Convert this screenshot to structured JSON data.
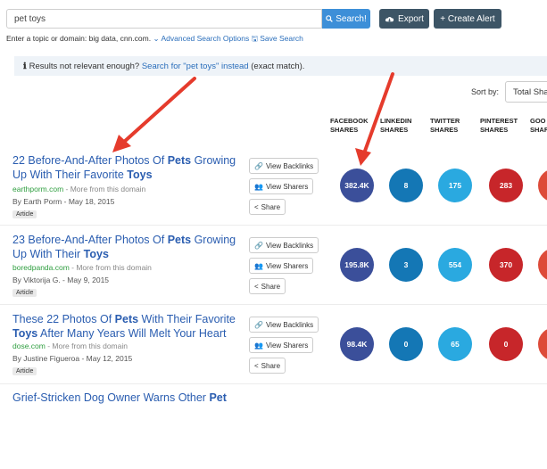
{
  "search": {
    "value": "pet toys",
    "button_label": "Search!",
    "export_label": "Export",
    "alert_label": "+ Create Alert"
  },
  "helper": {
    "text": "Enter a topic or domain: big data, cnn.com.",
    "advanced_link": "Advanced Search Options",
    "save_link": "Save Search"
  },
  "notice": {
    "prefix": "Results not relevant enough?",
    "link": "Search for \"pet toys\" instead",
    "suffix": "(exact match)."
  },
  "sort": {
    "label": "Sort by:",
    "selected": "Total Sha"
  },
  "columns": {
    "facebook": [
      "FACEBOOK",
      "SHARES"
    ],
    "linkedin": [
      "LINKEDIN",
      "SHARES"
    ],
    "twitter": [
      "TWITTER",
      "SHARES"
    ],
    "pinterest": [
      "PINTEREST",
      "SHARES"
    ],
    "google": [
      "GOO",
      "SHAR"
    ]
  },
  "actions": {
    "backlinks": "View Backlinks",
    "sharers": "View Sharers",
    "share": "Share"
  },
  "colors": {
    "facebook": "#3b4f9a",
    "linkedin": "#1477b5",
    "twitter": "#2aa9e0",
    "pinterest": "#c7262a",
    "google": "#dd4b39",
    "annotation_arrow": "#e53b2c"
  },
  "results": [
    {
      "title_parts": [
        [
          "22 Before-And-After Photos Of ",
          false
        ],
        [
          "Pets",
          true
        ],
        [
          " Growing Up With Their Favorite ",
          false
        ],
        [
          "Toys",
          true
        ]
      ],
      "domain": "earthporm.com",
      "more": " - More from this domain",
      "author": "By Earth Porm - May 18, 2015",
      "badge": "Article",
      "facebook": "382.4K",
      "linkedin": "8",
      "twitter": "175",
      "pinterest": "283"
    },
    {
      "title_parts": [
        [
          "23 Before-And-After Photos Of ",
          false
        ],
        [
          "Pets",
          true
        ],
        [
          " Growing Up With Their ",
          false
        ],
        [
          "Toys",
          true
        ]
      ],
      "domain": "boredpanda.com",
      "more": " - More from this domain",
      "author": "By Viktorija G. - May 9, 2015",
      "badge": "Article",
      "facebook": "195.8K",
      "linkedin": "3",
      "twitter": "554",
      "pinterest": "370"
    },
    {
      "title_parts": [
        [
          "These 22 Photos Of ",
          false
        ],
        [
          "Pets",
          true
        ],
        [
          " With Their Favorite ",
          false
        ],
        [
          "Toys",
          true
        ],
        [
          " After Many Years Will Melt Your Heart",
          false
        ]
      ],
      "domain": "dose.com",
      "more": " - More from this domain",
      "author": "By Justine Figueroa - May 12, 2015",
      "badge": "Article",
      "facebook": "98.4K",
      "linkedin": "0",
      "twitter": "65",
      "pinterest": "0"
    },
    {
      "title_parts": [
        [
          "Grief-Stricken Dog Owner Warns Other ",
          false
        ],
        [
          "Pet",
          true
        ]
      ],
      "domain": "",
      "more": "",
      "author": "",
      "badge": "",
      "facebook": "",
      "linkedin": "",
      "twitter": "",
      "pinterest": ""
    }
  ]
}
